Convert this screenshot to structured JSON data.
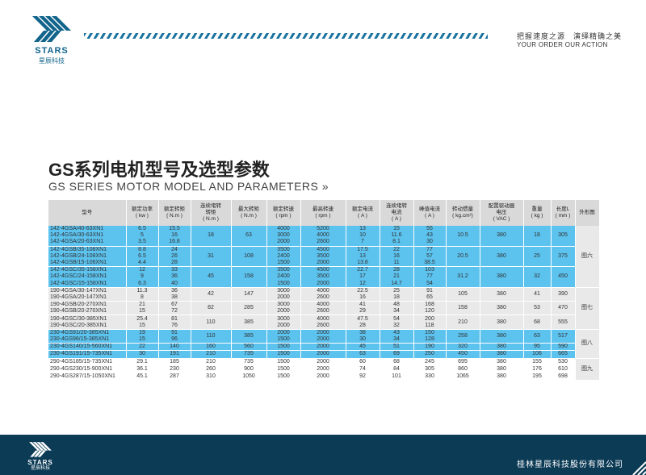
{
  "brand": {
    "logo_text": "STARS",
    "logo_subtext": "星辰科技",
    "accent_color": "#11658c",
    "slogan_cn": "把握速度之源　演绎精确之美",
    "slogan_en": "YOUR ORDER  OUR ACTION"
  },
  "page": {
    "title_cn": "GS系列电机型号及选型参数",
    "title_en": "GS SERIES MOTOR MODEL AND PARAMETERS",
    "title_en_arrow": "»"
  },
  "table": {
    "headers": [
      "型号",
      "额定功率\n( kw )",
      "额定转矩\n( N.m )",
      "连续堵转\n转矩\n( N.m )",
      "最大转矩\n( N.m )",
      "额定转速\n( rpm )",
      "最高转速\n( rpm )",
      "额定电流\n( A )",
      "连续堵转\n电流\n( A )",
      "峰值电流\n( A )",
      "转动惯量\n( kg.cm²)",
      "配置驱动器\n电压\n( VAC )",
      "重量\n( kg )",
      "长度L\n( mm )",
      "外形图"
    ],
    "rows": [
      [
        "142-4GSA/40-63XN1",
        "6.5",
        "15.5",
        "18",
        "63",
        "4000",
        "5200",
        "13",
        "15",
        "55",
        "10.5",
        "380",
        "18",
        "305"
      ],
      [
        "142-4GSA/30-63XN1",
        "5",
        "16",
        "",
        "",
        "3000",
        "4000",
        "10",
        "11.6",
        "43",
        "",
        "",
        "",
        ""
      ],
      [
        "142-4GSA/20-63XN1",
        "3.5",
        "16.8",
        "",
        "",
        "2000",
        "2600",
        "7",
        "8.1",
        "30",
        "",
        "",
        "",
        ""
      ],
      [
        "142-4GSB/35-108XN1",
        "8.8",
        "24",
        "31",
        "108",
        "3500",
        "4500",
        "17.5",
        "22",
        "77",
        "20.5",
        "380",
        "25",
        "375"
      ],
      [
        "142-4GSB/24-108XN1",
        "6.5",
        "26",
        "",
        "",
        "2400",
        "3500",
        "13",
        "16",
        "57",
        "",
        "",
        "",
        ""
      ],
      [
        "142-4GSB/15-108XN1",
        "4.4",
        "28",
        "",
        "",
        "1500",
        "2000",
        "13.8",
        "11",
        "38.5",
        "",
        "",
        "",
        ""
      ],
      [
        "142-4GSC/35-158XN1",
        "12",
        "33",
        "45",
        "158",
        "3500",
        "4500",
        "22.7",
        "28",
        "103",
        "31.2",
        "380",
        "32",
        "450"
      ],
      [
        "142-4GSC/24-158XN1",
        "9",
        "36",
        "",
        "",
        "2400",
        "3500",
        "17",
        "21",
        "77",
        "",
        "",
        "",
        ""
      ],
      [
        "142-4GSC/15-158XN1",
        "6.3",
        "40",
        "",
        "",
        "1500",
        "2000",
        "12",
        "14.7",
        "54",
        "",
        "",
        "",
        ""
      ],
      [
        "190-4GSA/30-147XN1",
        "11.3",
        "36",
        "42",
        "147",
        "3000",
        "4000",
        "22.5",
        "25",
        "91",
        "105",
        "380",
        "41",
        "390"
      ],
      [
        "190-4GSA/20-147XN1",
        "8",
        "38",
        "",
        "",
        "2000",
        "2600",
        "16",
        "18",
        "65",
        "",
        "",
        "",
        ""
      ],
      [
        "190-4GSB/20-270XN1",
        "21",
        "67",
        "82",
        "285",
        "3000",
        "4000",
        "41",
        "48",
        "168",
        "158",
        "380",
        "53",
        "470"
      ],
      [
        "190-4GSB/20-270XN1",
        "15",
        "72",
        "",
        "",
        "2000",
        "2600",
        "29",
        "34",
        "120",
        "",
        "",
        "",
        ""
      ],
      [
        "190-4GSC/30-385XN1",
        "25.4",
        "81",
        "110",
        "385",
        "3000",
        "4000",
        "47.5",
        "54",
        "200",
        "210",
        "380",
        "68",
        "555"
      ],
      [
        "190-4GSC/20-385XN1",
        "15",
        "76",
        "",
        "",
        "2000",
        "2600",
        "28",
        "32",
        "118",
        "",
        "",
        "",
        ""
      ],
      [
        "230-4GS91/20-385XN1",
        "19",
        "91",
        "110",
        "385",
        "2000",
        "2000",
        "38",
        "43",
        "150",
        "258",
        "380",
        "63",
        "517"
      ],
      [
        "230-4GS96/15-385XN1",
        "15",
        "96",
        "",
        "",
        "1500",
        "2000",
        "30",
        "34",
        "128",
        "",
        "",
        "",
        ""
      ],
      [
        "230-4GS140/15-560XN1",
        "22",
        "140",
        "160",
        "560",
        "1500",
        "2000",
        "45",
        "51",
        "190",
        "320",
        "380",
        "95",
        "590"
      ],
      [
        "230-4GS191/15-735XN1",
        "30",
        "191",
        "210",
        "735",
        "1500",
        "2000",
        "63",
        "69",
        "250",
        "450",
        "380",
        "106",
        "665"
      ],
      [
        "290-4GS185/15-735XN1",
        "29.1",
        "185",
        "210",
        "735",
        "1500",
        "2000",
        "60",
        "68",
        "245",
        "695",
        "380",
        "155",
        "530"
      ],
      [
        "290-4GS230/15-900XN1",
        "36.1",
        "230",
        "260",
        "900",
        "1500",
        "2000",
        "74",
        "84",
        "305",
        "860",
        "380",
        "176",
        "610"
      ],
      [
        "290-4GS287/15-1050XN1",
        "45.1",
        "287",
        "310",
        "1050",
        "1500",
        "2000",
        "92",
        "101",
        "330",
        "1065",
        "380",
        "195",
        "698"
      ]
    ],
    "shape_labels": [
      "图六",
      "图七",
      "图八",
      "图九"
    ],
    "colors": {
      "blue": "#5cc2ee",
      "grey": "#e9e9e9",
      "header": "#d9d9d9"
    }
  },
  "footer": {
    "logo_text": "STARS",
    "logo_subtext": "星辰科技",
    "company": "桂林星辰科技股份有限公司",
    "background": "#0c3b56"
  }
}
